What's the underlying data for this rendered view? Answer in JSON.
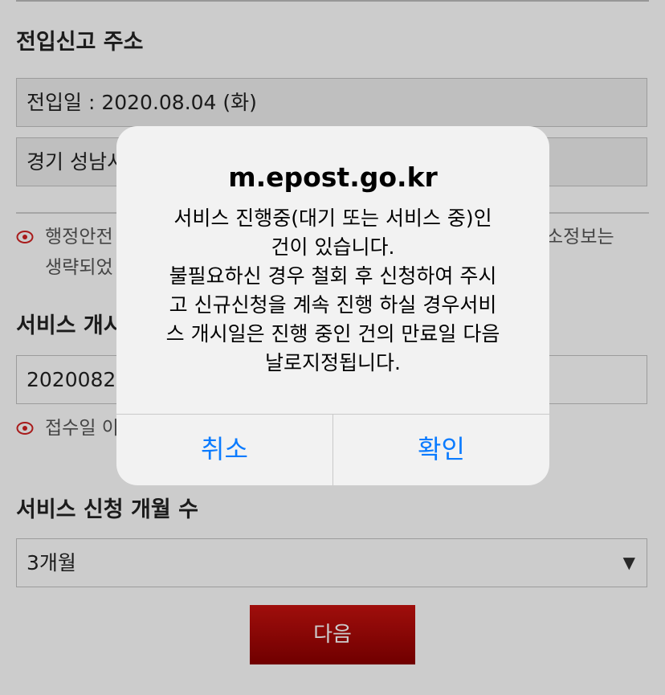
{
  "sections": {
    "move_in_title": "전입신고 주소",
    "move_in_date": "전입일 : 2020.08.04 (화)",
    "address_line": "경기 성남시",
    "note1_line1": "행정안전",
    "note1_line1_right": "소정보는",
    "note1_line2": "생략되었",
    "service_start_title": "서비스 개시",
    "service_start_value": "2020082",
    "note2": "접수일 이",
    "months_title": "서비스 신청 개월 수",
    "months_value": "3개월",
    "next_button": "다음"
  },
  "dialog": {
    "title": "m.epost.go.kr",
    "message": "서비스 진행중(대기 또는 서비스 중)인\n건이 있습니다.\n불필요하신 경우 철회 후 신청하여 주시\n고 신규신청을 계속 진행 하실 경우서비\n스 개시일은 진행 중인 건의 만료일 다음\n날로지정됩니다.",
    "cancel_label": "취소",
    "confirm_label": "확인"
  },
  "icons": {
    "note_icon": "eye-icon",
    "select_arrow": "triangle-down-icon"
  },
  "colors": {
    "accent_red": "#c8120f",
    "ios_blue": "#0a7bff"
  }
}
